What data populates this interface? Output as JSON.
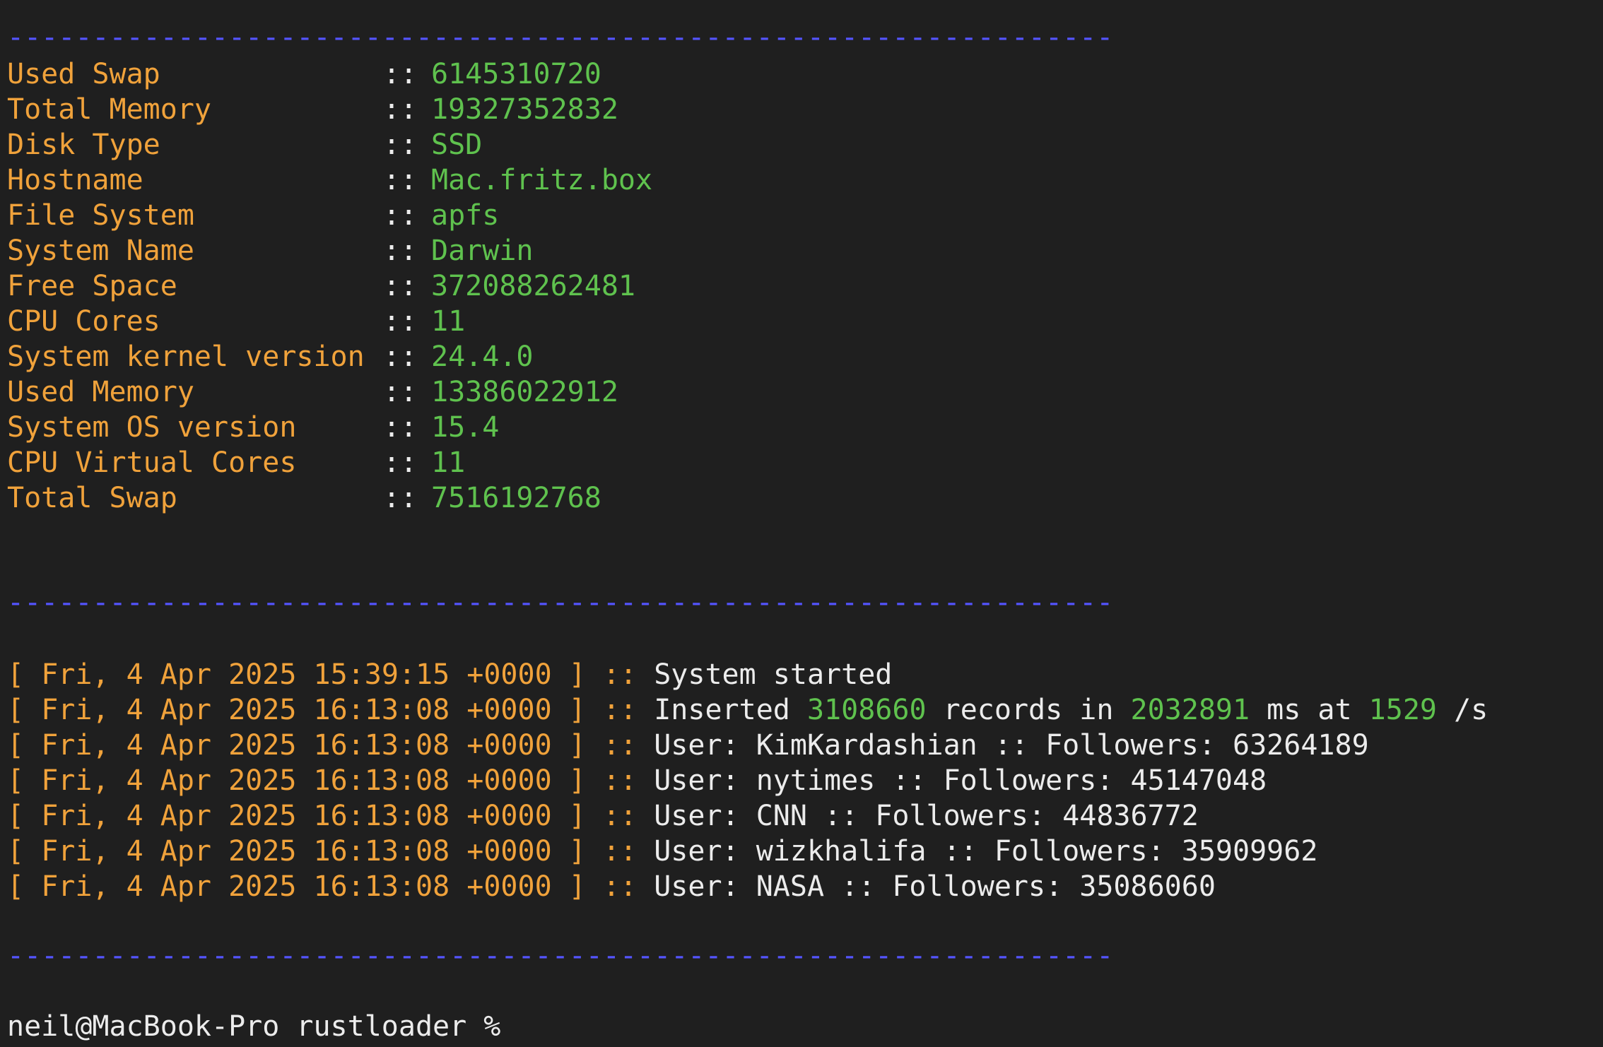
{
  "separator": "-----------------------------------------------------------------",
  "sysinfo": [
    {
      "key": "Used Swap",
      "value": "6145310720"
    },
    {
      "key": "Total Memory",
      "value": "19327352832"
    },
    {
      "key": "Disk Type",
      "value": "SSD"
    },
    {
      "key": "Hostname",
      "value": "Mac.fritz.box"
    },
    {
      "key": "File System",
      "value": "apfs"
    },
    {
      "key": "System Name",
      "value": "Darwin"
    },
    {
      "key": "Free Space",
      "value": "372088262481"
    },
    {
      "key": "CPU Cores",
      "value": "11"
    },
    {
      "key": "System kernel version",
      "value": "24.4.0"
    },
    {
      "key": "Used Memory",
      "value": "13386022912"
    },
    {
      "key": "System OS version",
      "value": "15.4"
    },
    {
      "key": "CPU Virtual Cores",
      "value": "11"
    },
    {
      "key": "Total Swap",
      "value": "7516192768"
    }
  ],
  "kv_delim": ":: ",
  "log": {
    "open_bracket": "[",
    "close_bracket": "]",
    "delim": "::",
    "entries": [
      {
        "timestamp": "Fri, 4 Apr 2025 15:39:15 +0000",
        "message": "System started"
      },
      {
        "timestamp": "Fri, 4 Apr 2025 16:13:08 +0000",
        "inserted": {
          "prefix": "Inserted ",
          "records": "3108660",
          "mid1": " records in ",
          "ms": "2032891",
          "mid2": " ms at ",
          "rate": "1529",
          "suffix": " /s"
        }
      },
      {
        "timestamp": "Fri, 4 Apr 2025 16:13:08 +0000",
        "message": "User: KimKardashian :: Followers: 63264189"
      },
      {
        "timestamp": "Fri, 4 Apr 2025 16:13:08 +0000",
        "message": "User: nytimes :: Followers: 45147048"
      },
      {
        "timestamp": "Fri, 4 Apr 2025 16:13:08 +0000",
        "message": "User: CNN :: Followers: 44836772"
      },
      {
        "timestamp": "Fri, 4 Apr 2025 16:13:08 +0000",
        "message": "User: wizkhalifa :: Followers: 35909962"
      },
      {
        "timestamp": "Fri, 4 Apr 2025 16:13:08 +0000",
        "message": "User: NASA :: Followers: 35086060"
      }
    ]
  },
  "prompt": "neil@MacBook-Pro rustloader % ",
  "colors": {
    "background": "#1f1f1f",
    "key": "#f0a23b",
    "value": "#5fc24e",
    "separator": "#5454ff",
    "text": "#ececec"
  }
}
